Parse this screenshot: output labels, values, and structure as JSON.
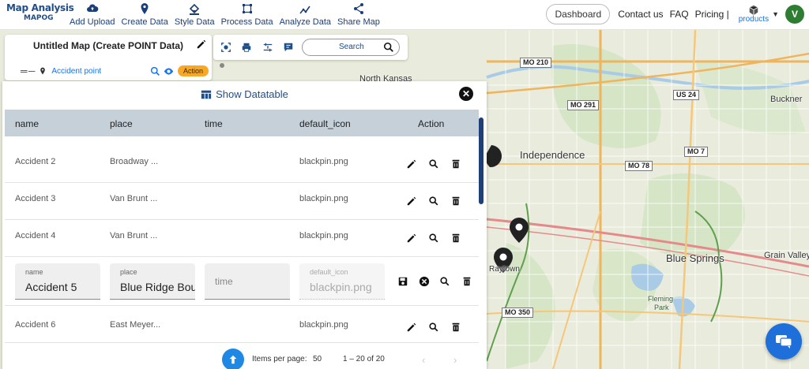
{
  "brand": {
    "title": "Map Analysis",
    "sub": "MAPOG"
  },
  "nav": [
    {
      "label": "Add Upload",
      "icon": "cloud-upload-icon"
    },
    {
      "label": "Create Data",
      "icon": "map-pin-icon"
    },
    {
      "label": "Style Data",
      "icon": "paint-bucket-icon"
    },
    {
      "label": "Process Data",
      "icon": "process-icon"
    },
    {
      "label": "Analyze Data",
      "icon": "analyze-icon"
    },
    {
      "label": "Share Map",
      "icon": "share-icon"
    }
  ],
  "right_nav": {
    "dashboard": "Dashboard",
    "contact": "Contact us",
    "faq": "FAQ",
    "pricing": "Pricing |",
    "products": "products",
    "avatar_initial": "V"
  },
  "panel": {
    "map_title": "Untitled Map (Create POINT Data)",
    "layer_name": "Accident point",
    "action_label": "Action"
  },
  "toolbar": {
    "search_label": "Search"
  },
  "map_labels": {
    "independence": "Independence",
    "blue_springs": "Blue Springs",
    "grain_valley": "Grain Valley",
    "buckner": "Buckner",
    "raytown": "Raytown",
    "north_kansas": "North Kansas",
    "fleming": "Fleming",
    "park": "Park",
    "mo210": "MO 210",
    "mo291": "MO 291",
    "us24": "US 24",
    "mo7": "MO 7",
    "mo78": "MO 78",
    "mo350": "MO 350"
  },
  "datatable": {
    "title": "Show Datatable",
    "columns": [
      "name",
      "place",
      "time",
      "default_icon",
      "Action"
    ],
    "rows": [
      {
        "name": "Accident 2",
        "place": "Broadway ...",
        "time": "",
        "icon": "blackpin.png"
      },
      {
        "name": "Accident 3",
        "place": "Van Brunt ...",
        "time": "",
        "icon": "blackpin.png"
      },
      {
        "name": "Accident 4",
        "place": "Van Brunt ...",
        "time": "",
        "icon": "blackpin.png"
      }
    ],
    "edit_row": {
      "name_label": "name",
      "name_value": "Accident 5",
      "place_label": "place",
      "place_value": "Blue Ridge Bou",
      "time_placeholder": "time",
      "icon_label": "default_icon",
      "icon_value": "blackpin.png"
    },
    "last_row": {
      "name": "Accident 6",
      "place": "East Meyer...",
      "time": "",
      "icon": "blackpin.png"
    },
    "pager": {
      "items_per_page": "Items per page:",
      "per_page_value": "50",
      "range": "1 – 20 of 20"
    }
  },
  "colors": {
    "accent": "#1f4e8c",
    "action": "#f9a825",
    "header_row": "#c5d0d9",
    "avatar": "#2f7d32"
  }
}
